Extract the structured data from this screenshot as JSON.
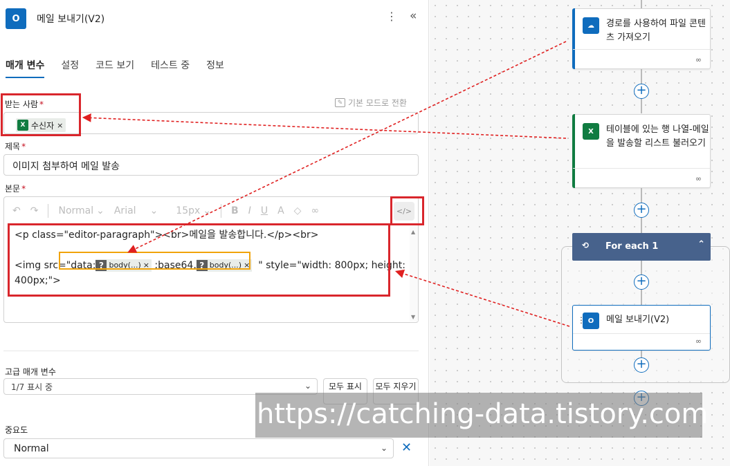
{
  "header": {
    "icon_text": "O",
    "title": "메일 보내기(V2)",
    "more_glyph": "⋮",
    "collapse_glyph": "«"
  },
  "tabs": [
    {
      "label": "매개 변수"
    },
    {
      "label": "설정"
    },
    {
      "label": "코드 보기"
    },
    {
      "label": "테스트 중"
    },
    {
      "label": "정보"
    }
  ],
  "to": {
    "label": "받는 사람",
    "required": "*",
    "switch_mode": "기본 모드로 전환",
    "token": "수신자",
    "token_remove": "×"
  },
  "subject": {
    "label": "제목",
    "required": "*",
    "value": "이미지 첨부하여 메일 발송"
  },
  "body": {
    "label": "본문",
    "required": "*",
    "toolbar": {
      "format": "Normal",
      "font": "Arial",
      "size": "15px",
      "code_glyph": "</>"
    },
    "code_line1": "<p class=\"editor-paragraph\"><br>메일을 발송합니다.</p><br>",
    "img_prefix": "<img src=",
    "data_prefix": "\"data:",
    "token1": "body(...)",
    "mid": ";base64,",
    "token2": "body(...)",
    "token_q": "?",
    "token_x": "×",
    "quote": "\"",
    "img_suffix": "style=\"width: 800px; height:",
    "code_line4": "400px;\">"
  },
  "advanced": {
    "label": "고급 매개 변수",
    "select_value": "1/7 표시 중",
    "show_all": "모두 표시",
    "clear_all": "모두 지우기"
  },
  "importance": {
    "label": "중요도",
    "value": "Normal",
    "clear_glyph": "✕"
  },
  "flow": {
    "card1": {
      "title": "경로를 사용하여 파일 콘텐츠 가져오기",
      "color": "#0f6cbd"
    },
    "card2": {
      "title": "테이블에 있는 행 나열-메일을 발송할 리스트 불러오기",
      "color": "#107c41"
    },
    "foreach": {
      "title": "For each 1",
      "color": "#47628c"
    },
    "card3": {
      "title": "메일 보내기(V2)",
      "color": "#0f6cbd"
    },
    "plus_glyph": "+"
  },
  "watermark": "https://catching-data.tistory.com"
}
